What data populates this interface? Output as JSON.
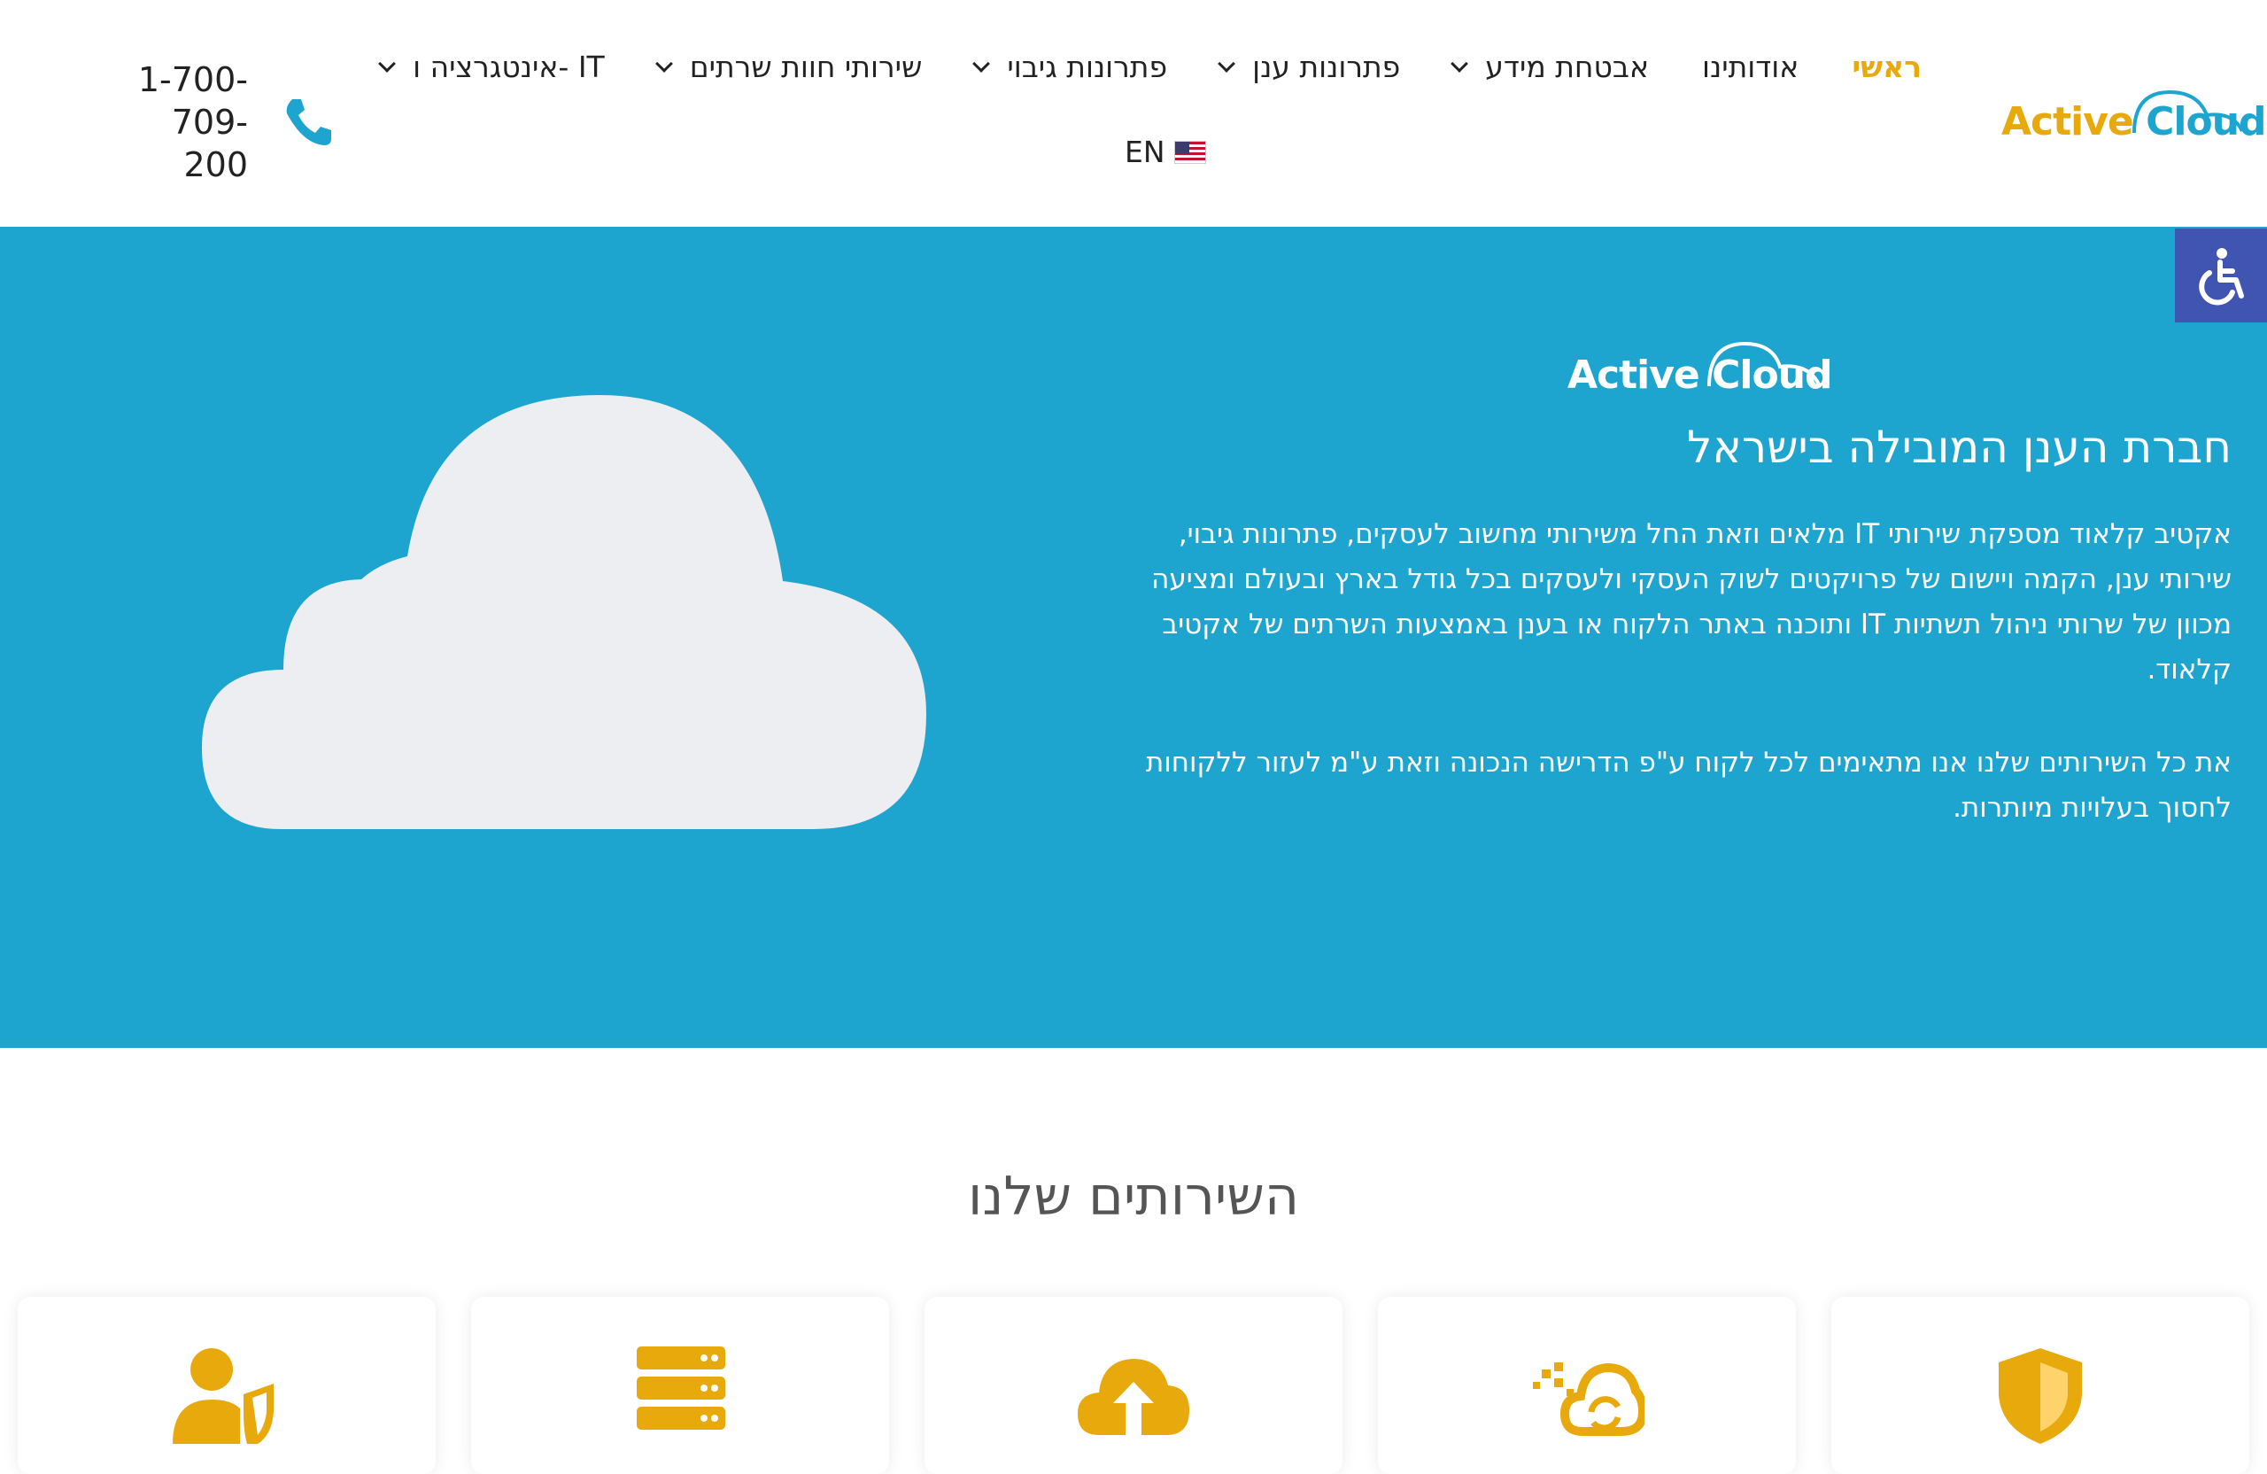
{
  "header": {
    "logo": {
      "word1": "Active",
      "word2": "Cloud"
    },
    "nav": [
      {
        "label": "ראשי",
        "active": true,
        "dropdown": false
      },
      {
        "label": "אודותינו",
        "active": false,
        "dropdown": false
      },
      {
        "label": "אבטחת מידע",
        "active": false,
        "dropdown": true
      },
      {
        "label": "פתרונות ענן",
        "active": false,
        "dropdown": true
      },
      {
        "label": "פתרונות גיבוי",
        "active": false,
        "dropdown": true
      },
      {
        "label": "שירותי חוות שרתים",
        "active": false,
        "dropdown": true
      },
      {
        "label": "אינטגרציה ו- IT",
        "active": false,
        "dropdown": true
      }
    ],
    "language": "EN",
    "phone_line1": "1-700-709-",
    "phone_line2": "200"
  },
  "hero": {
    "logo": {
      "word1": "Active",
      "word2": "Cloud"
    },
    "title": "חברת הענן המובילה בישראל",
    "paragraph1": "אקטיב קלאוד מספקת שירותי IT מלאים וזאת החל משירותי מחשוב לעסקים, פתרונות גיבוי, שירותי ענן, הקמה ויישום של פרויקטים לשוק העסקי ולעסקים בכל גודל בארץ ובעולם ומציעה מכוון של שרותי ניהול תשתיות IT ותוכנה באתר הלקוח או בענן באמצעות השרתים של אקטיב קלאוד.",
    "paragraph2": "את כל השירותים שלנו אנו מתאימים לכל לקוח ע\"פ הדרישה הנכונה וזאת ע\"מ לעזור ללקוחות לחסוך בעלויות מיותרות."
  },
  "services": {
    "title": "השירותים שלנו",
    "cards": [
      {
        "icon": "user-shield-icon"
      },
      {
        "icon": "server-icon"
      },
      {
        "icon": "cloud-upload-icon"
      },
      {
        "icon": "cloud-sync-icon"
      },
      {
        "icon": "shield-icon"
      }
    ]
  },
  "colors": {
    "brand_blue": "#1da5d0",
    "brand_gold": "#e8a90c",
    "accessibility_bg": "#4054b2",
    "cloud_fill": "#eceef1"
  }
}
